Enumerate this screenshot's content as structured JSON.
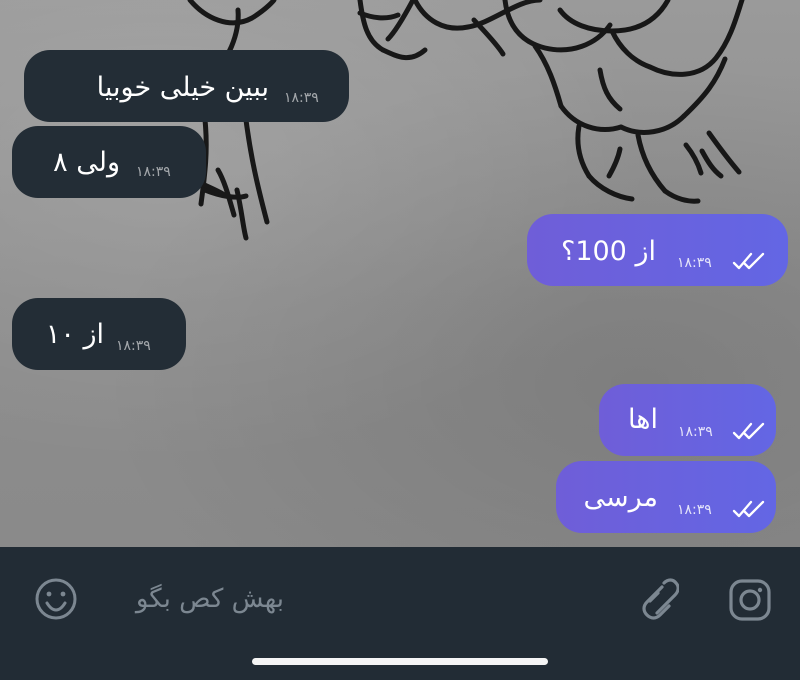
{
  "messages": [
    {
      "id": "m1",
      "direction": "incoming",
      "text": "ببین خیلی خوبیا",
      "time": "۱۸:۳۹"
    },
    {
      "id": "m2",
      "direction": "incoming",
      "text": "ولی ۸",
      "time": "۱۸:۳۹"
    },
    {
      "id": "m3",
      "direction": "outgoing",
      "text": "از 100؟",
      "time": "۱۸:۳۹",
      "status_icon": "double-check-icon"
    },
    {
      "id": "m4",
      "direction": "incoming",
      "text": "از ۱۰",
      "time": "۱۸:۳۹"
    },
    {
      "id": "m5",
      "direction": "outgoing",
      "text": "اها",
      "time": "۱۸:۳۹",
      "status_icon": "double-check-icon"
    },
    {
      "id": "m6",
      "direction": "outgoing",
      "text": "مرسی",
      "time": "۱۸:۳۹",
      "status_icon": "double-check-icon"
    }
  ],
  "composer": {
    "placeholder": "بهش کص بگو",
    "left_icon": "emoji-icon",
    "right_icons": [
      "attachment-icon",
      "instagram-icon"
    ]
  },
  "colors": {
    "incoming_bubble": "#232d36",
    "outgoing_bubble": "#6766e2",
    "composer_bar": "#222c35",
    "placeholder_text": "#7c8791",
    "icon": "#7c8791"
  }
}
